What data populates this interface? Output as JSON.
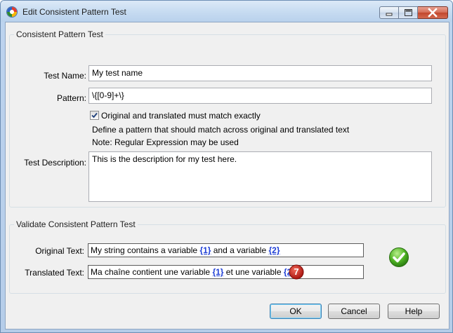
{
  "window": {
    "title": "Edit Consistent Pattern Test",
    "icon": "app-logo-icon"
  },
  "pattern_group": {
    "title": "Consistent Pattern Test",
    "test_name_label": "Test Name:",
    "test_name_value": "My test name",
    "pattern_label": "Pattern:",
    "pattern_value": "\\{[0-9]+\\}",
    "match_exact_label": "Original and translated must match exactly",
    "match_exact_checked": true,
    "hint_1": "Define a pattern that should match across original and translated text",
    "hint_2": "Note: Regular Expression may be used",
    "description_label": "Test Description:",
    "description_value": "This is the description for my test here."
  },
  "validate_group": {
    "title": "Validate Consistent Pattern Test",
    "original_label": "Original Text:",
    "original_parts": [
      "My string contains a variable ",
      "{1}",
      " and a variable ",
      "{2}"
    ],
    "translated_label": "Translated Text:",
    "translated_parts": [
      "Ma chaîne contient une variable ",
      "{1}",
      " et une variable ",
      "{2}"
    ],
    "error_badge": "7",
    "status_icon": "green-check-icon"
  },
  "buttons": {
    "ok": "OK",
    "cancel": "Cancel",
    "help": "Help"
  },
  "colors": {
    "variable": "#1f3fd6",
    "error_badge": "#c8231c",
    "success": "#3aa01d"
  }
}
